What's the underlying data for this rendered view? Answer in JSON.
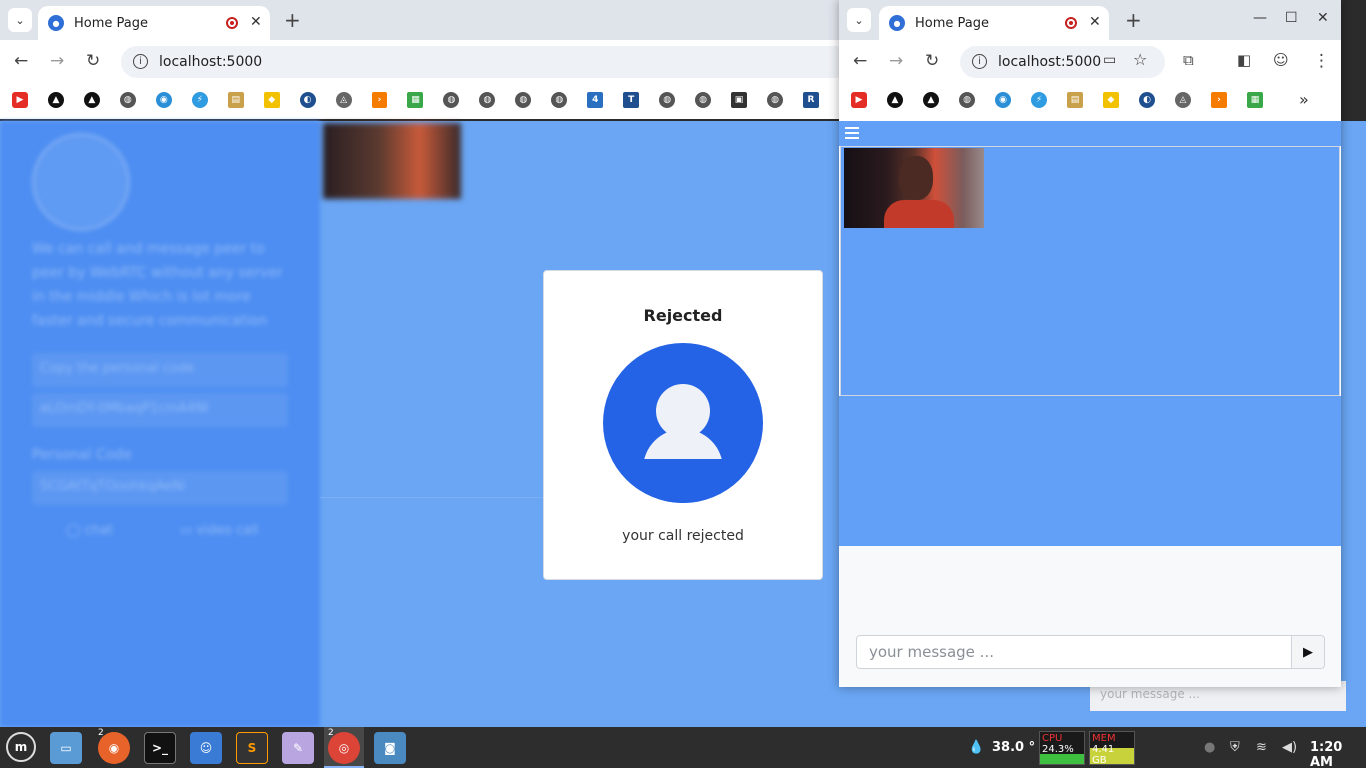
{
  "left_window": {
    "tab_title": "Home Page",
    "url": "localhost:5000",
    "new_tab": "+",
    "close": "✕"
  },
  "right_window": {
    "tab_title": "Home Page",
    "url": "localhost:5000",
    "new_tab": "+",
    "close": "✕",
    "more_bookmarks": "»"
  },
  "sidebar": {
    "description": "We can call and message peer to peer by WebRTC without any server in the middle Which is lot more faster and secure communication",
    "copy_label": "Copy the personal code",
    "copy_code": "aLOmDY-0MbaqP1cmA4NI",
    "personal_code_label": "Personal Code",
    "personal_code_value": "5CGAtTqTOoohkqAeNi",
    "chat_button": "chat",
    "video_button": "video call"
  },
  "modal": {
    "title": "Rejected",
    "message": "your call rejected"
  },
  "ghost_input": "your message ...",
  "chat": {
    "placeholder": "your message ...",
    "send_icon": "▶"
  },
  "taskbar": {
    "firefox_badge": "2",
    "chrome_badge": "2",
    "temperature": "38.0 °",
    "cpu_label": "CPU",
    "cpu_value": "24.3%",
    "mem_label": "MEM",
    "mem_value": "4.41 GB",
    "clock": "1:20 AM"
  },
  "colors": {
    "accent": "#2563e6",
    "page_bg": "#6aa6f4",
    "right_bg": "#62a0f8"
  }
}
